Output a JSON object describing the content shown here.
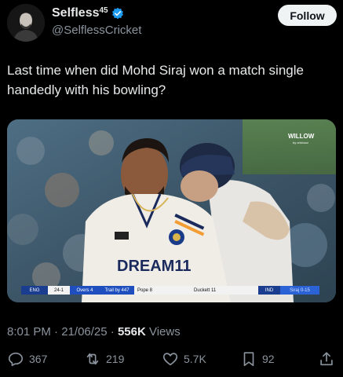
{
  "author": {
    "display_name": "Selfless",
    "name_superscript": "45",
    "handle": "@SelflessCricket",
    "verified": true
  },
  "follow_label": "Follow",
  "tweet_text": "Last time when did Mohd Siraj won a match single handedly with his bowling?",
  "media": {
    "watermark": "WILLOW",
    "watermark_sub": "by cricbuzz",
    "jersey_text": "DREAM11",
    "scorebar": {
      "team": "ENG",
      "score": "24-1",
      "overs": "Overs 4",
      "trail": "Trail by 447",
      "batter1": "Pope 8",
      "batter2": "Duckett 11",
      "bowling_team": "IND",
      "bowler": "Siraj 0-15"
    }
  },
  "meta": {
    "time": "8:01 PM",
    "date": "21/06/25",
    "views_count": "556K",
    "views_label": "Views"
  },
  "actions": {
    "replies": "367",
    "reposts": "219",
    "likes": "5.7K",
    "bookmarks": "92"
  }
}
